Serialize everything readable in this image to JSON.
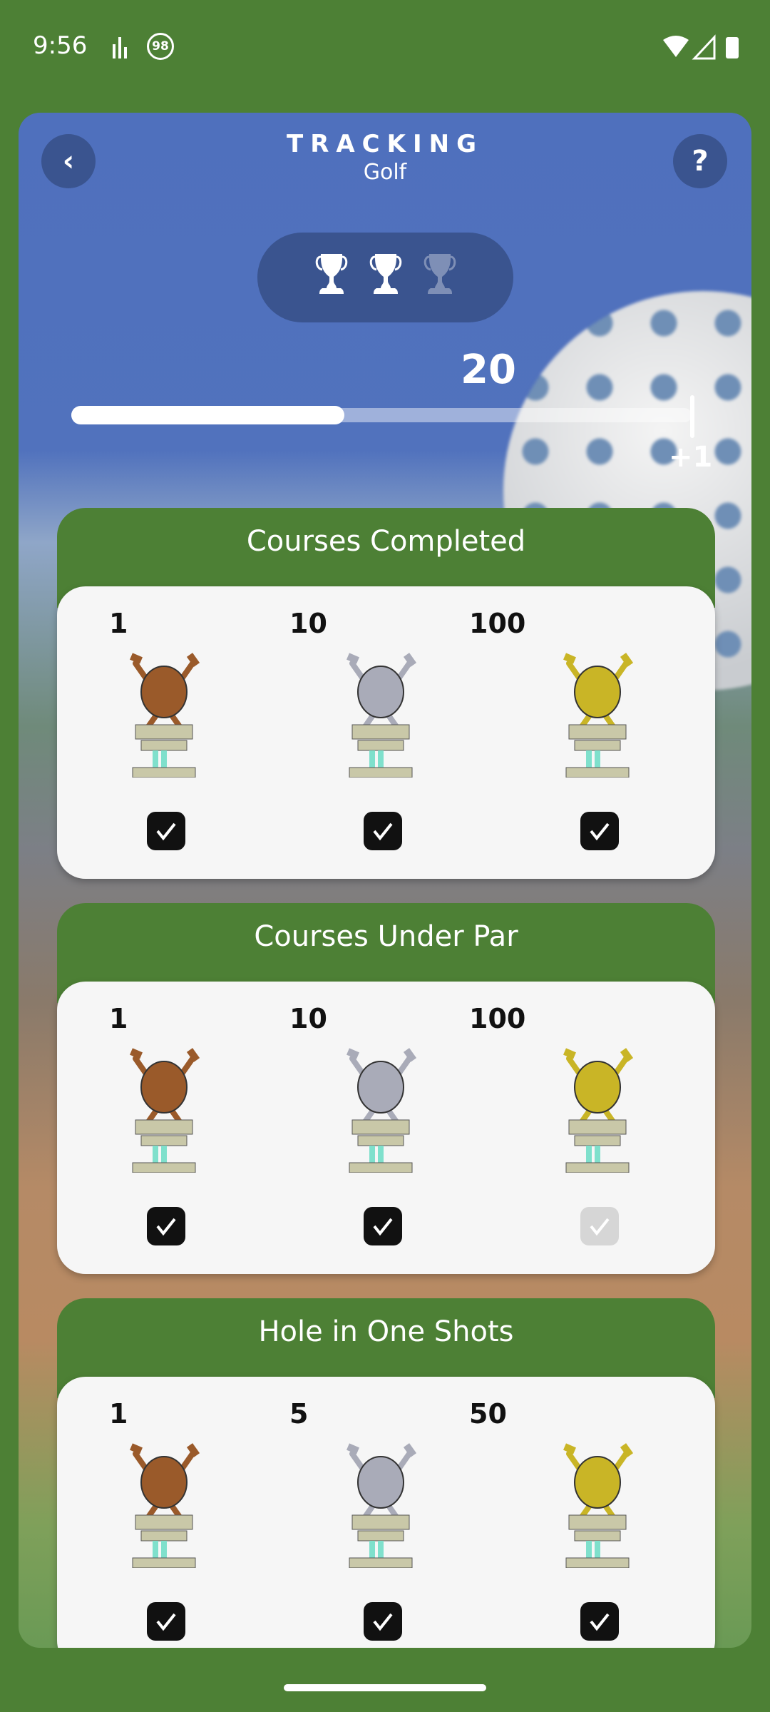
{
  "status": {
    "time": "9:56",
    "badge": "98"
  },
  "header": {
    "title": "TRACKING",
    "subtitle": "Golf",
    "back_icon": "chevron-left-icon",
    "help_label": "?"
  },
  "trophies": {
    "earned": 2,
    "total": 3
  },
  "progress": {
    "value": "20",
    "fraction": 0.44,
    "increment": "+1"
  },
  "colors": {
    "green": "#4d8035",
    "blue": "#4f70bd",
    "bronze": "#9a5a2a",
    "silver": "#a9abb8",
    "gold": "#c9b526"
  },
  "sections": [
    {
      "title": "Courses Completed",
      "tiers": [
        {
          "goal": "1",
          "tier": "bronze",
          "done": true
        },
        {
          "goal": "10",
          "tier": "silver",
          "done": true
        },
        {
          "goal": "100",
          "tier": "gold",
          "done": true
        }
      ]
    },
    {
      "title": "Courses Under Par",
      "tiers": [
        {
          "goal": "1",
          "tier": "bronze",
          "done": true
        },
        {
          "goal": "10",
          "tier": "silver",
          "done": true
        },
        {
          "goal": "100",
          "tier": "gold",
          "done": false
        }
      ]
    },
    {
      "title": "Hole in One Shots",
      "tiers": [
        {
          "goal": "1",
          "tier": "bronze",
          "done": true
        },
        {
          "goal": "5",
          "tier": "silver",
          "done": true
        },
        {
          "goal": "50",
          "tier": "gold",
          "done": true
        }
      ]
    }
  ]
}
